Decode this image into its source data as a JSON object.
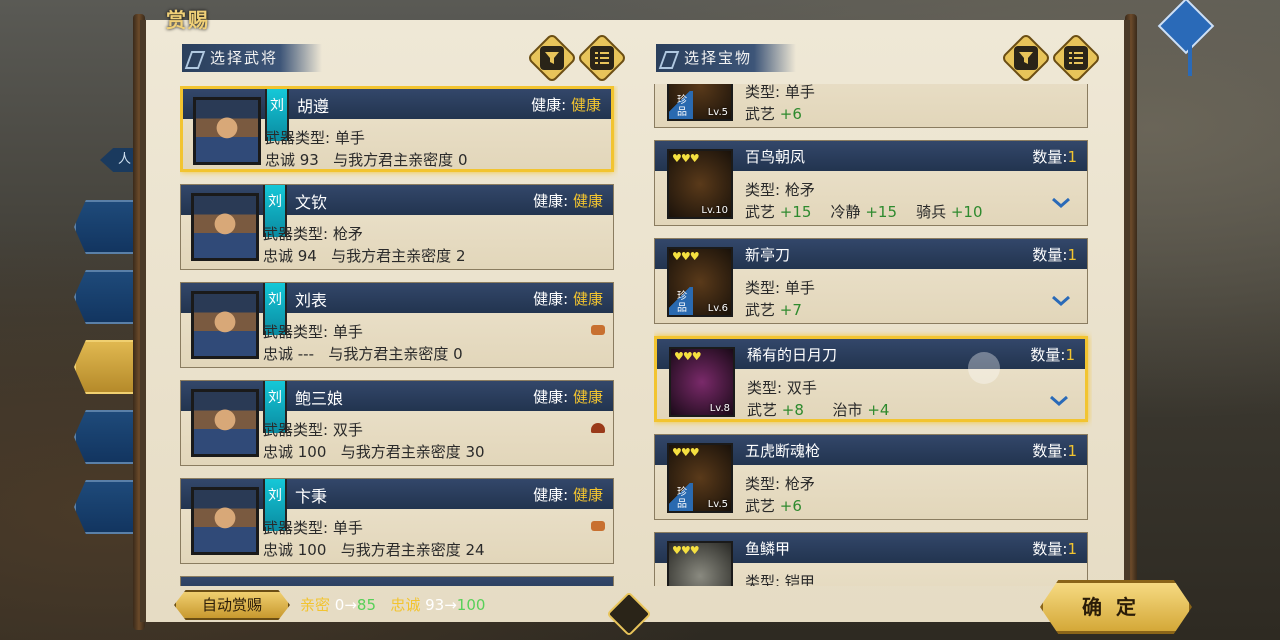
{
  "window": {
    "title": "赏赐"
  },
  "side": {
    "tag": "人"
  },
  "heroes_panel": {
    "header": "选择武将",
    "filter_icon": "filter-icon",
    "list_icon": "list-icon",
    "heroes": [
      {
        "faction": "刘",
        "name": "胡遵",
        "health_label": "健康:",
        "health_value": "健康",
        "weapon": "武器类型: 单手",
        "loyalty": "忠诚 93",
        "intimacy": "与我方君主亲密度 0",
        "selected": true
      },
      {
        "faction": "刘",
        "name": "文钦",
        "health_label": "健康:",
        "health_value": "健康",
        "weapon": "武器类型: 枪矛",
        "loyalty": "忠诚 94",
        "intimacy": "与我方君主亲密度 2",
        "selected": false
      },
      {
        "faction": "刘",
        "name": "刘表",
        "health_label": "健康:",
        "health_value": "健康",
        "weapon": "武器类型: 单手",
        "loyalty": "忠诚 ---",
        "intimacy": "与我方君主亲密度 0",
        "selected": false
      },
      {
        "faction": "刘",
        "name": "鲍三娘",
        "health_label": "健康:",
        "health_value": "健康",
        "weapon": "武器类型: 双手",
        "loyalty": "忠诚 100",
        "intimacy": "与我方君主亲密度 30",
        "selected": false
      },
      {
        "faction": "刘",
        "name": "卞秉",
        "health_label": "健康:",
        "health_value": "健康",
        "weapon": "武器类型: 单手",
        "loyalty": "忠诚 100",
        "intimacy": "与我方君主亲密度 24",
        "selected": false
      }
    ]
  },
  "items_panel": {
    "header": "选择宝物",
    "items": [
      {
        "name": "",
        "qty_label": "",
        "qty": "",
        "lv": "Lv.5",
        "rare": "珍品",
        "type": "类型: 单手",
        "stats": [
          {
            "k": "武艺",
            "v": "+6"
          }
        ]
      },
      {
        "name": "百鸟朝凤",
        "qty_label": "数量:",
        "qty": "1",
        "lv": "Lv.10",
        "rare": "",
        "type": "类型: 枪矛",
        "stats": [
          {
            "k": "武艺",
            "v": "+15"
          },
          {
            "k": "冷静",
            "v": "+15"
          },
          {
            "k": "骑兵",
            "v": "+10"
          }
        ]
      },
      {
        "name": "新亭刀",
        "qty_label": "数量:",
        "qty": "1",
        "lv": "Lv.6",
        "rare": "珍品",
        "type": "类型: 单手",
        "stats": [
          {
            "k": "武艺",
            "v": "+7"
          }
        ]
      },
      {
        "name": "稀有的日月刀",
        "qty_label": "数量:",
        "qty": "1",
        "lv": "Lv.8",
        "rare": "",
        "type": "类型: 双手",
        "stats": [
          {
            "k": "武艺",
            "v": "+8"
          },
          {
            "k": "治市",
            "v": "+4"
          }
        ]
      },
      {
        "name": "五虎断魂枪",
        "qty_label": "数量:",
        "qty": "1",
        "lv": "Lv.5",
        "rare": "珍品",
        "type": "类型: 枪矛",
        "stats": [
          {
            "k": "武艺",
            "v": "+6"
          }
        ]
      },
      {
        "name": "鱼鳞甲",
        "qty_label": "数量:",
        "qty": "1",
        "lv": "",
        "rare": "",
        "type": "类型: 铠甲",
        "stats": []
      }
    ]
  },
  "bottom": {
    "auto_label": "自动赏赐",
    "intimacy_label": "亲密",
    "intimacy_from": "0",
    "intimacy_to": "85",
    "loyalty_label": "忠诚",
    "loyalty_from": "93",
    "loyalty_to": "100",
    "arrow": "→",
    "confirm_label": "确定"
  },
  "colors": {
    "gold": "#f2c430",
    "bar": "#2c3f5e",
    "stat_green": "#2e8a2e",
    "new_value_green": "#58d058"
  }
}
